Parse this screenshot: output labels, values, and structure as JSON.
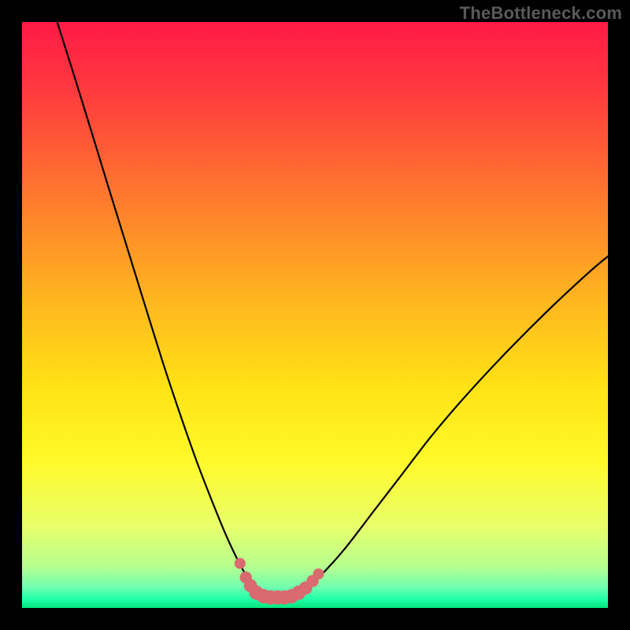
{
  "watermark": "TheBottleneck.com",
  "chart_data": {
    "type": "line",
    "title": "",
    "xlabel": "",
    "ylabel": "",
    "xlim": [
      0,
      100
    ],
    "ylim": [
      0,
      100
    ],
    "background_gradient": {
      "stops": [
        {
          "offset": 0.0,
          "color": "#ff1a46"
        },
        {
          "offset": 0.12,
          "color": "#ff3b3e"
        },
        {
          "offset": 0.3,
          "color": "#ff7a2e"
        },
        {
          "offset": 0.48,
          "color": "#ffb81f"
        },
        {
          "offset": 0.62,
          "color": "#ffe216"
        },
        {
          "offset": 0.75,
          "color": "#fff92a"
        },
        {
          "offset": 0.86,
          "color": "#e8ff6a"
        },
        {
          "offset": 0.93,
          "color": "#b6ff8f"
        },
        {
          "offset": 0.965,
          "color": "#6fffb0"
        },
        {
          "offset": 0.985,
          "color": "#1fffa8"
        },
        {
          "offset": 1.0,
          "color": "#00e57b"
        }
      ]
    },
    "series": [
      {
        "name": "bottleneck-curve",
        "note": "V-shaped curve; y in percent (100 = top of plot, 0 = bottom). Values estimated from pixels.",
        "x": [
          6,
          9,
          12,
          15,
          18,
          21,
          24,
          27,
          30,
          33,
          35,
          37,
          38.5,
          40,
          41.5,
          43,
          44.5,
          46,
          48,
          51,
          55,
          60,
          65,
          70,
          76,
          83,
          90,
          97,
          100
        ],
        "y": [
          100,
          90.5,
          80.8,
          71.0,
          61.3,
          51.6,
          42.0,
          33.0,
          24.5,
          16.8,
          12.0,
          7.8,
          5.2,
          3.4,
          2.4,
          2.0,
          2.0,
          2.2,
          3.2,
          5.6,
          10.0,
          16.5,
          23.0,
          29.5,
          36.5,
          44.0,
          51.0,
          57.5,
          60.0
        ]
      }
    ],
    "markers": {
      "name": "trough-markers",
      "color": "#d96a6f",
      "points": [
        {
          "x": 37.2,
          "y": 7.6,
          "r": 1.0
        },
        {
          "x": 38.2,
          "y": 5.2,
          "r": 1.1
        },
        {
          "x": 39.0,
          "y": 3.8,
          "r": 1.2
        },
        {
          "x": 40.0,
          "y": 2.6,
          "r": 1.3
        },
        {
          "x": 41.2,
          "y": 2.0,
          "r": 1.3
        },
        {
          "x": 42.4,
          "y": 1.8,
          "r": 1.3
        },
        {
          "x": 43.6,
          "y": 1.8,
          "r": 1.3
        },
        {
          "x": 44.8,
          "y": 1.8,
          "r": 1.3
        },
        {
          "x": 46.0,
          "y": 2.0,
          "r": 1.3
        },
        {
          "x": 47.2,
          "y": 2.6,
          "r": 1.3
        },
        {
          "x": 48.4,
          "y": 3.4,
          "r": 1.2
        },
        {
          "x": 49.6,
          "y": 4.6,
          "r": 1.1
        },
        {
          "x": 50.6,
          "y": 5.8,
          "r": 1.0
        }
      ]
    }
  }
}
